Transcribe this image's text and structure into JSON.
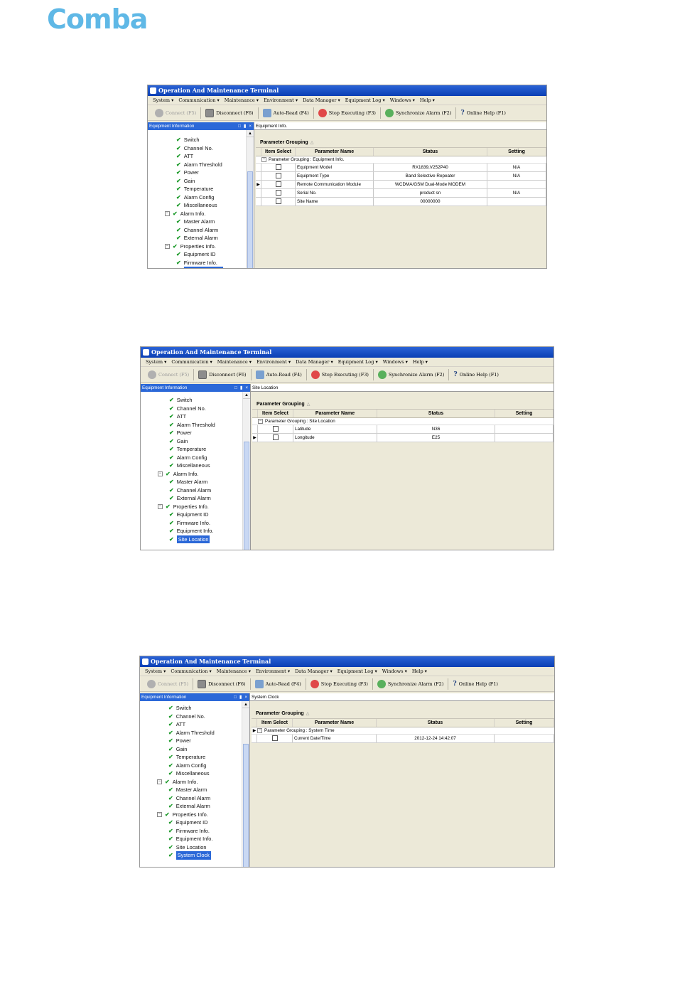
{
  "logo": "Comba",
  "screenshots": [
    {
      "window_title": "Operation And Maintenance Terminal",
      "menu": [
        "System ▾",
        "Communication ▾",
        "Maintenance ▾",
        "Environment ▾",
        "Data Manager ▾",
        "Equipment Log ▾",
        "Windows ▾",
        "Help ▾"
      ],
      "toolbar": [
        "Connect (F5)",
        "Disconnect (F6)",
        "Auto-Read (F4)",
        "Stop Executing (F3)",
        "Synchronize Alarm (F2)",
        "Online Help (F1)"
      ],
      "pane_title": "Equipment Information",
      "tab_title": "Equipment Info.",
      "group_title": "Parameter Grouping",
      "columns": [
        "Item Select",
        "Parameter Name",
        "Status",
        "Setting"
      ],
      "group_label": "Parameter Grouping : Equipment Info.",
      "rows": [
        {
          "name": "Equipment Model",
          "status": "RX1839,V252P40",
          "setting": "N/A",
          "arrow": ""
        },
        {
          "name": "Equipment Type",
          "status": "Band Selective Repeater",
          "setting": "N/A",
          "arrow": ""
        },
        {
          "name": "Remote Communication Module",
          "status": "WCDMA/GSM Dual-Mode MODEM",
          "setting": "",
          "arrow": "▶"
        },
        {
          "name": "Serial No.",
          "status": "product sn",
          "setting": "N/A",
          "arrow": ""
        },
        {
          "name": "Site Name",
          "status": "00000000",
          "setting": "",
          "arrow": ""
        }
      ],
      "tree": [
        {
          "label": "Switch",
          "level": 2
        },
        {
          "label": "Channel No.",
          "level": 2
        },
        {
          "label": "ATT",
          "level": 2
        },
        {
          "label": "Alarm Threshold",
          "level": 2
        },
        {
          "label": "Power",
          "level": 2
        },
        {
          "label": "Gain",
          "level": 2
        },
        {
          "label": "Temperature",
          "level": 2
        },
        {
          "label": "Alarm Config",
          "level": 2
        },
        {
          "label": "Miscellaneous",
          "level": 2
        },
        {
          "label": "Alarm Info.",
          "level": 1
        },
        {
          "label": "Master Alarm",
          "level": 2
        },
        {
          "label": "Channel Alarm",
          "level": 2
        },
        {
          "label": "External Alarm",
          "level": 2
        },
        {
          "label": "Properties Info.",
          "level": 1
        },
        {
          "label": "Equipment ID",
          "level": 2
        },
        {
          "label": "Firmware Info.",
          "level": 2
        },
        {
          "label": "Equipment Info.",
          "level": 2,
          "selected": true
        }
      ]
    },
    {
      "window_title": "Operation And Maintenance Terminal",
      "menu": [
        "System ▾",
        "Communication ▾",
        "Maintenance ▾",
        "Environment ▾",
        "Data Manager ▾",
        "Equipment Log ▾",
        "Windows ▾",
        "Help ▾"
      ],
      "toolbar": [
        "Connect (F5)",
        "Disconnect (F6)",
        "Auto-Read (F4)",
        "Stop Executing (F3)",
        "Synchronize Alarm (F2)",
        "Online Help (F1)"
      ],
      "pane_title": "Equipment Information",
      "tab_title": "Site Location",
      "group_title": "Parameter Grouping",
      "columns": [
        "Item Select",
        "Parameter Name",
        "Status",
        "Setting"
      ],
      "group_label": "Parameter Grouping : Site Location",
      "rows": [
        {
          "name": "Latitude",
          "status": "N36",
          "setting": "",
          "arrow": ""
        },
        {
          "name": "Longitude",
          "status": "E25",
          "setting": "",
          "arrow": "▶"
        }
      ],
      "tree": [
        {
          "label": "Switch",
          "level": 2
        },
        {
          "label": "Channel No.",
          "level": 2
        },
        {
          "label": "ATT",
          "level": 2
        },
        {
          "label": "Alarm Threshold",
          "level": 2
        },
        {
          "label": "Power",
          "level": 2
        },
        {
          "label": "Gain",
          "level": 2
        },
        {
          "label": "Temperature",
          "level": 2
        },
        {
          "label": "Alarm Config",
          "level": 2
        },
        {
          "label": "Miscellaneous",
          "level": 2
        },
        {
          "label": "Alarm Info.",
          "level": 1
        },
        {
          "label": "Master Alarm",
          "level": 2
        },
        {
          "label": "Channel Alarm",
          "level": 2
        },
        {
          "label": "External Alarm",
          "level": 2
        },
        {
          "label": "Properties Info.",
          "level": 1
        },
        {
          "label": "Equipment ID",
          "level": 2
        },
        {
          "label": "Firmware Info.",
          "level": 2
        },
        {
          "label": "Equipment Info.",
          "level": 2
        },
        {
          "label": "Site Location",
          "level": 2,
          "selected": true
        }
      ]
    },
    {
      "window_title": "Operation And Maintenance Terminal",
      "menu": [
        "System ▾",
        "Communication ▾",
        "Maintenance ▾",
        "Environment ▾",
        "Data Manager ▾",
        "Equipment Log ▾",
        "Windows ▾",
        "Help ▾"
      ],
      "toolbar": [
        "Connect (F5)",
        "Disconnect (F6)",
        "Auto-Read (F4)",
        "Stop Executing (F3)",
        "Synchronize Alarm (F2)",
        "Online Help (F1)"
      ],
      "pane_title": "Equipment Information",
      "tab_title": "System Clock",
      "group_title": "Parameter Grouping",
      "columns": [
        "Item Select",
        "Parameter Name",
        "Status",
        "Setting"
      ],
      "group_label": "Parameter Grouping : System Time",
      "group_arrow": "▶",
      "rows": [
        {
          "name": "Current Date/Time",
          "status": "2012-12-24 14:42:07",
          "setting": "",
          "arrow": ""
        }
      ],
      "tree": [
        {
          "label": "Switch",
          "level": 2
        },
        {
          "label": "Channel No.",
          "level": 2
        },
        {
          "label": "ATT",
          "level": 2
        },
        {
          "label": "Alarm Threshold",
          "level": 2
        },
        {
          "label": "Power",
          "level": 2
        },
        {
          "label": "Gain",
          "level": 2
        },
        {
          "label": "Temperature",
          "level": 2
        },
        {
          "label": "Alarm Config",
          "level": 2
        },
        {
          "label": "Miscellaneous",
          "level": 2
        },
        {
          "label": "Alarm Info.",
          "level": 1
        },
        {
          "label": "Master Alarm",
          "level": 2
        },
        {
          "label": "Channel Alarm",
          "level": 2
        },
        {
          "label": "External Alarm",
          "level": 2
        },
        {
          "label": "Properties Info.",
          "level": 1
        },
        {
          "label": "Equipment ID",
          "level": 2
        },
        {
          "label": "Firmware Info.",
          "level": 2
        },
        {
          "label": "Equipment Info.",
          "level": 2
        },
        {
          "label": "Site Location",
          "level": 2
        },
        {
          "label": "System Clock",
          "level": 2,
          "selected": true
        }
      ]
    }
  ]
}
